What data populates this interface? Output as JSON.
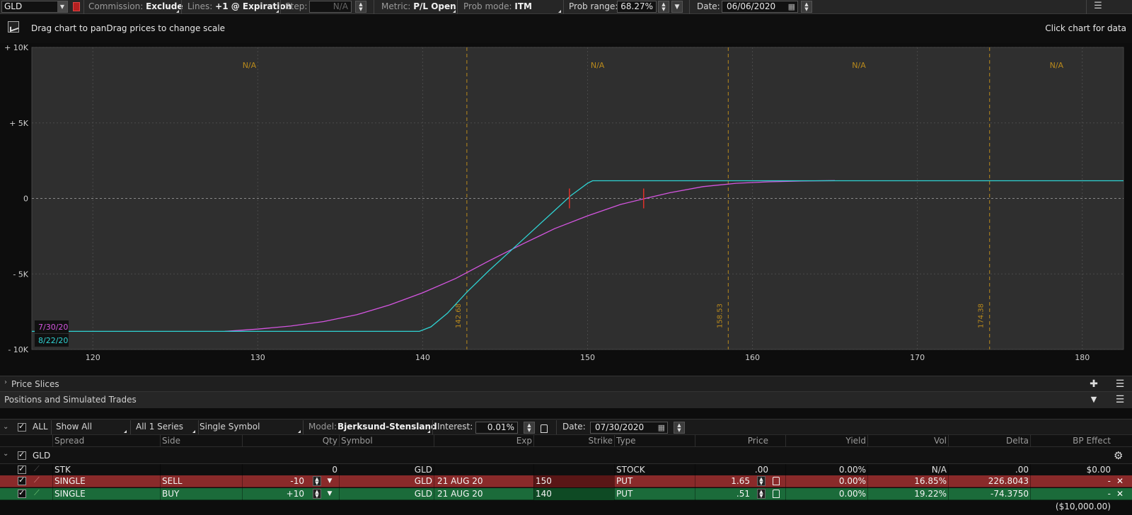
{
  "toolbar": {
    "symbol": "GLD",
    "commission_label": "Commission:",
    "commission_value": "Exclude",
    "lines_label": "Lines:",
    "lines_value": "+1 @ Expiration",
    "step_label": "Step:",
    "step_value": "N/A",
    "metric_label": "Metric:",
    "metric_value": "P/L Open",
    "prob_mode_label": "Prob mode:",
    "prob_mode_value": "ITM",
    "prob_range_label": "Prob range:",
    "prob_range_value": "68.27%",
    "date_label": "Date:",
    "date_value": "06/06/2020"
  },
  "hint": {
    "left": "Drag chart to panDrag prices to change scale",
    "right": "Click chart for data"
  },
  "chart_data": {
    "type": "line",
    "x_ticks": [
      "120",
      "130",
      "140",
      "150",
      "160",
      "170",
      "180"
    ],
    "y_ticks": [
      "+ 10K",
      "+ 5K",
      "0",
      "- 5K",
      "- 10K"
    ],
    "xlim": [
      116.3,
      182.5
    ],
    "ylim": [
      -10000,
      10000
    ],
    "grid": true,
    "legend_position": "bottom-left",
    "vertical_markers": [
      {
        "x": 142.68,
        "label": "142.68"
      },
      {
        "x": 158.53,
        "label": "158.53"
      },
      {
        "x": 174.38,
        "label": "174.38"
      }
    ],
    "band_labels": [
      "N/A",
      "N/A",
      "N/A",
      "N/A"
    ],
    "series": [
      {
        "name": "7/30/20",
        "color": "#d455e0",
        "x": [
          128,
          130,
          132,
          134,
          136,
          138,
          140,
          142,
          144,
          146,
          148,
          150,
          152,
          153.5,
          155,
          157,
          159,
          161,
          163,
          165
        ],
        "y": [
          -8800,
          -8650,
          -8450,
          -8150,
          -7700,
          -7050,
          -6250,
          -5300,
          -4150,
          -3050,
          -2000,
          -1150,
          -400,
          0,
          380,
          780,
          1000,
          1100,
          1150,
          1180
        ]
      },
      {
        "name": "8/22/20",
        "color": "#2fd3d3",
        "x": [
          116.3,
          139.8,
          140.5,
          141.5,
          142.68,
          144,
          146,
          148,
          149,
          150,
          150.3,
          182.5
        ],
        "y": [
          -8800,
          -8800,
          -8500,
          -7600,
          -6200,
          -4800,
          -2800,
          -800,
          200,
          1000,
          1170,
          1170
        ]
      }
    ],
    "break_even_marks": [
      148.9,
      153.4
    ]
  },
  "price_slices": {
    "title": "Price Slices"
  },
  "positions": {
    "title": "Positions and Simulated Trades",
    "filters": {
      "all_label": "ALL",
      "show": "Show All",
      "series": "All 1 Series",
      "symbol_mode": "Single Symbol",
      "model_label": "Model:",
      "model_value": "Bjerksund-Stensland",
      "interest_label": "Interest:",
      "interest_value": "0.01%",
      "date_label": "Date:",
      "date_value": "07/30/2020"
    },
    "columns": [
      "Spread",
      "Side",
      "Qty",
      "Symbol",
      "Exp",
      "Strike",
      "Type",
      "Price",
      "Yield",
      "Vol",
      "Delta",
      "BP Effect"
    ],
    "group_name": "GLD",
    "rows": [
      {
        "spread": "STK",
        "side": "",
        "qty": "0",
        "symbol": "GLD",
        "exp": "",
        "strike": "",
        "type": "STOCK",
        "price": ".00",
        "yield": "0.00%",
        "vol": "N/A",
        "delta": ".00",
        "bp": "$0.00"
      },
      {
        "spread": "SINGLE",
        "side": "SELL",
        "qty": "-10",
        "symbol": "GLD",
        "exp": "21 AUG 20",
        "strike": "150",
        "type": "PUT",
        "price": "1.65",
        "yield": "0.00%",
        "vol": "16.85%",
        "delta": "226.8043",
        "bp": "-"
      },
      {
        "spread": "SINGLE",
        "side": "BUY",
        "qty": "+10",
        "symbol": "GLD",
        "exp": "21 AUG 20",
        "strike": "140",
        "type": "PUT",
        "price": ".51",
        "yield": "0.00%",
        "vol": "19.22%",
        "delta": "-74.3750",
        "bp": "-"
      }
    ],
    "total_bp": "($10,000.00)"
  }
}
